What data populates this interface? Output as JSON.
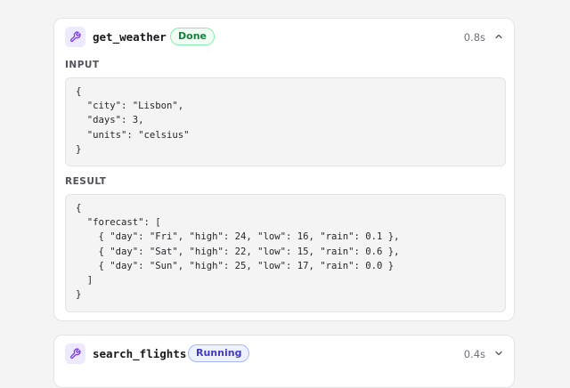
{
  "calls": [
    {
      "tool_name": "get_weather",
      "status": "Done",
      "duration": "0.8s",
      "expanded": true,
      "input_label": "INPUT",
      "input_json": "{\n  \"city\": \"Lisbon\",\n  \"days\": 3,\n  \"units\": \"celsius\"\n}",
      "result_label": "RESULT",
      "result_json": "{\n  \"forecast\": [\n    { \"day\": \"Fri\", \"high\": 24, \"low\": 16, \"rain\": 0.1 },\n    { \"day\": \"Sat\", \"high\": 22, \"low\": 15, \"rain\": 0.6 },\n    { \"day\": \"Sun\", \"high\": 25, \"low\": 17, \"rain\": 0.0 }\n  ]\n}",
      "icon": "wrench-icon",
      "chevron_icon": "chevron-up-icon"
    },
    {
      "tool_name": "search_flights",
      "status": "Running",
      "duration": "0.4s",
      "expanded": false,
      "icon": "wrench-icon",
      "chevron_icon": "chevron-down-icon"
    }
  ],
  "colors": {
    "done": "#15803d",
    "running": "#4338ca",
    "icon_accent": "#7c3aed"
  }
}
